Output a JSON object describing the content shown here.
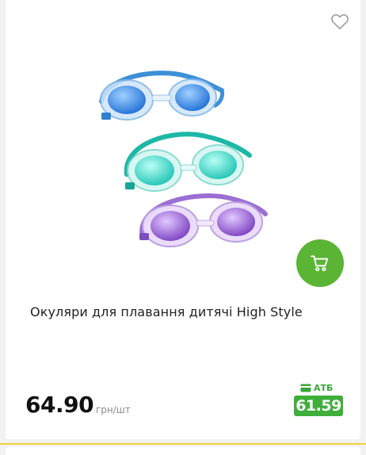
{
  "product": {
    "title": "Окуляри для плавання дитячі High Style",
    "price": "64.90",
    "unit": "грн/шт",
    "promo_label": "АТБ",
    "promo_price": "61.59"
  },
  "icons": {
    "favorite": "heart-outline-icon",
    "cart": "cart-icon",
    "promo": "card-icon"
  },
  "colors": {
    "cart_button": "#5ab534",
    "promo_badge": "#3fae3a",
    "accent_line": "#f2d23a"
  }
}
